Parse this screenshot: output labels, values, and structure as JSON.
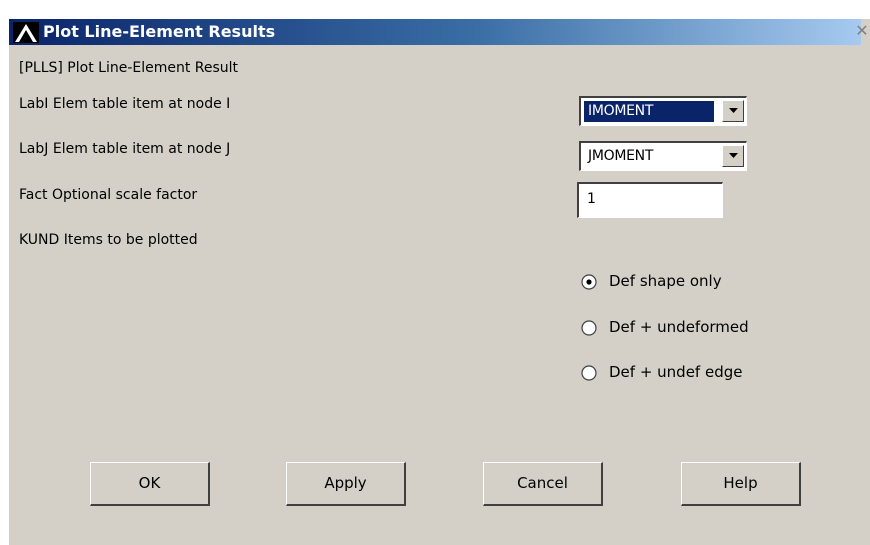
{
  "window": {
    "title": "Plot Line-Element Results",
    "close_glyph": "✕"
  },
  "form": {
    "header": "[PLLS] Plot Line-Element Result",
    "labi_label": "LabI  Elem table item at node I",
    "labi_value": "IMOMENT",
    "labj_label": "LabJ  Elem table item at node J",
    "labj_value": "JMOMENT",
    "fact_label": "Fact  Optional scale factor",
    "fact_value": "1",
    "kund_label": "KUND   Items to be plotted",
    "kund_options": [
      {
        "label": "Def shape only",
        "selected": true
      },
      {
        "label": "Def + undeformed",
        "selected": false
      },
      {
        "label": "Def + undef edge",
        "selected": false
      }
    ]
  },
  "buttons": {
    "ok": "OK",
    "apply": "Apply",
    "cancel": "Cancel",
    "help": "Help"
  },
  "icons": {
    "title_icon": "ansys-logo-icon",
    "dropdown": "chevron-down-icon"
  },
  "colors": {
    "titlebar_start": "#0a246a",
    "titlebar_end": "#a6caf0",
    "dialog_bg": "#d4d0c8",
    "selection": "#0a246a"
  }
}
